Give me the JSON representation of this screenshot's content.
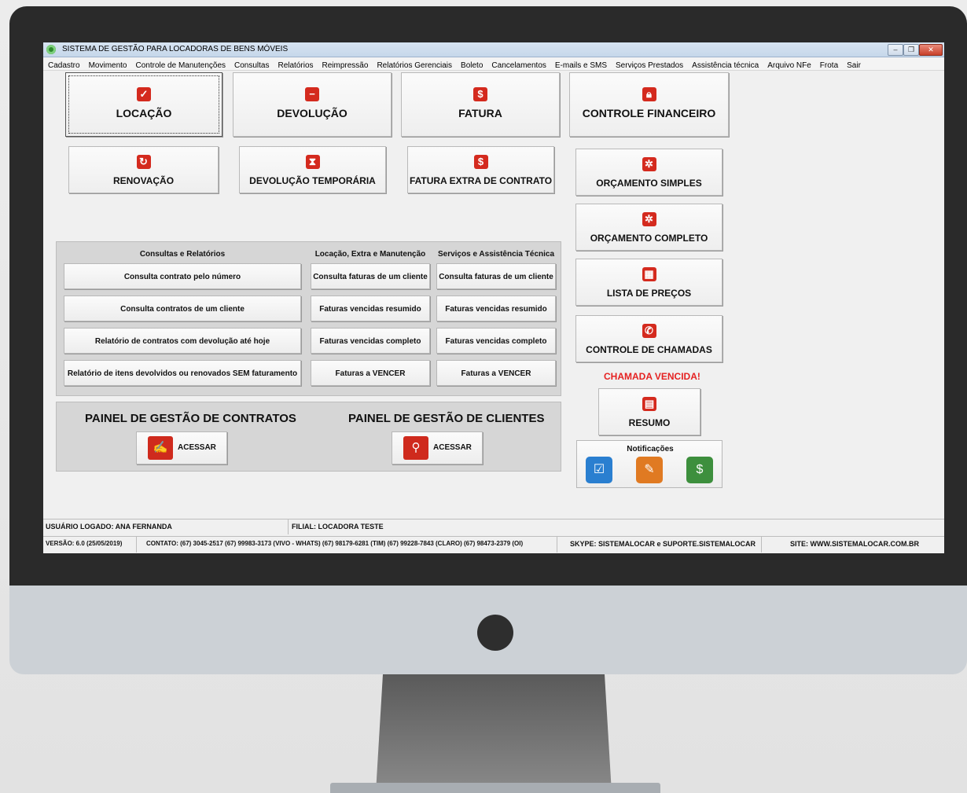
{
  "window": {
    "title": "SISTEMA DE GESTÃO PARA LOCADORAS DE BENS MÓVEIS"
  },
  "menu": [
    "Cadastro",
    "Movimento",
    "Controle de Manutenções",
    "Consultas",
    "Relatórios",
    "Reimpressão",
    "Relatórios Gerenciais",
    "Boleto",
    "Cancelamentos",
    "E-mails e SMS",
    "Serviços Prestados",
    "Assistência técnica",
    "Arquivo NFe",
    "Frota",
    "Sair"
  ],
  "main_buttons": {
    "locacao": "LOCAÇÃO",
    "devolucao": "DEVOLUÇÃO",
    "fatura": "FATURA",
    "controle_financeiro": "CONTROLE FINANCEIRO",
    "renovacao": "RENOVAÇÃO",
    "devolucao_temporaria": "DEVOLUÇÃO TEMPORÁRIA",
    "fatura_extra": "FATURA EXTRA DE CONTRATO"
  },
  "side_buttons": {
    "orcamento_simples": "ORÇAMENTO SIMPLES",
    "orcamento_completo": "ORÇAMENTO COMPLETO",
    "lista_precos": "LISTA DE PREÇOS",
    "controle_chamadas": "CONTROLE DE CHAMADAS",
    "chamada_vencida": "CHAMADA VENCIDA!",
    "resumo": "RESUMO",
    "notificacoes": "Notificações"
  },
  "panel": {
    "col1_header": "Consultas e Relatórios",
    "col2_header": "Locação, Extra e Manutenção",
    "col3_header": "Serviços e Assistência Técnica",
    "col1": [
      "Consulta contrato pelo número",
      "Consulta contratos de um cliente",
      "Relatório de contratos com devolução até hoje",
      "Relatório de itens devolvidos ou renovados SEM faturamento"
    ],
    "col2": [
      "Consulta faturas de um cliente",
      "Faturas vencidas resumido",
      "Faturas vencidas completo",
      "Faturas a VENCER"
    ],
    "col3": [
      "Consulta faturas de um cliente",
      "Faturas vencidas resumido",
      "Faturas vencidas completo",
      "Faturas a VENCER"
    ]
  },
  "gestao": {
    "contratos_title": "PAINEL DE GESTÃO DE CONTRATOS",
    "clientes_title": "PAINEL DE GESTÃO DE CLIENTES",
    "acessar": "ACESSAR"
  },
  "status": {
    "usuario": "USUÁRIO LOGADO: ANA FERNANDA",
    "filial": "FILIAL: LOCADORA TESTE",
    "versao": "VERSÃO: 6.0 (25/05/2019)",
    "contato": "CONTATO: (67) 3045-2517 (67) 99983-3173 (VIVO - WHATS)  (67) 98179-6281 (TIM) (67) 99228-7843 (CLARO) (67) 98473-2379 (OI)",
    "skype": "SKYPE: SISTEMALOCAR e SUPORTE.SISTEMALOCAR",
    "site": "SITE: WWW.SISTEMALOCAR.COM.BR"
  },
  "colors": {
    "accent_red": "#d42a1e",
    "warn_red": "#e52222",
    "notif_blue": "#2a7fd0",
    "notif_orange": "#e07a22",
    "notif_green": "#3d8f3d"
  }
}
